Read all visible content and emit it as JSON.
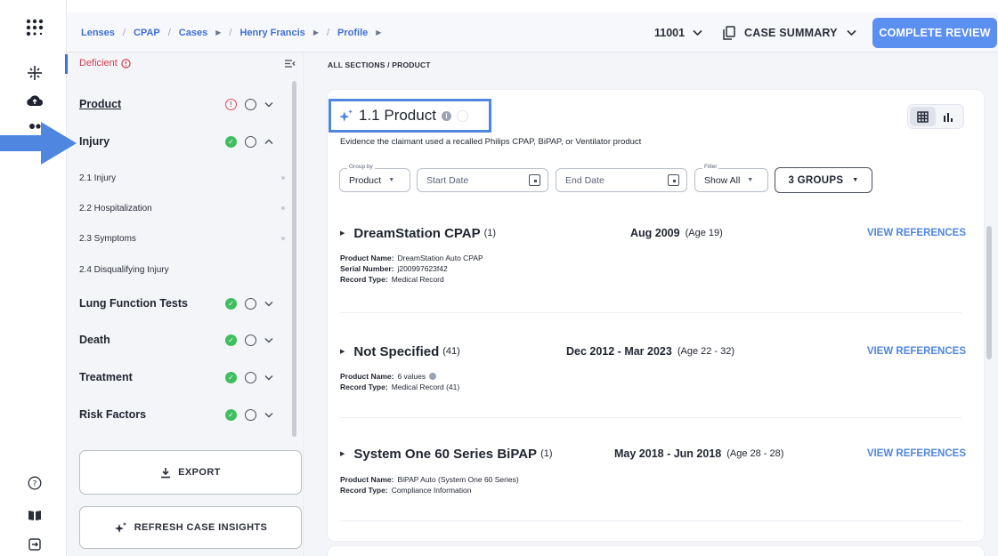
{
  "topbar": {
    "breadcrumbs": [
      "Lenses",
      "CPAP",
      "Cases",
      "Henry Francis",
      "Profile"
    ],
    "case_id": "11001",
    "summary_label": "CASE SUMMARY",
    "complete_label": "COMPLETE REVIEW"
  },
  "sidebar": {
    "filter_label": "Deficient",
    "sections": [
      {
        "label": "Product",
        "status": "deficient"
      },
      {
        "label": "Injury",
        "status": "ok"
      },
      {
        "label": "Lung Function Tests",
        "status": "ok"
      },
      {
        "label": "Death",
        "status": "ok"
      },
      {
        "label": "Treatment",
        "status": "ok"
      },
      {
        "label": "Risk Factors",
        "status": "ok"
      }
    ],
    "subsections": [
      "2.1 Injury",
      "2.2 Hospitalization",
      "2.3 Symptoms",
      "2.4 Disqualifying Injury"
    ],
    "export_label": "EXPORT",
    "refresh_label": "REFRESH CASE INSIGHTS"
  },
  "main": {
    "path": "ALL SECTIONS  /  PRODUCT",
    "title": "1.1 Product",
    "description": "Evidence the claimant used a recalled Philips CPAP, BiPAP, or Ventilator product",
    "filters": {
      "group_by_label": "Group by",
      "group_by_value": "Product",
      "start_date_placeholder": "Start Date",
      "end_date_placeholder": "End Date",
      "filter_label": "Filter",
      "filter_value": "Show All",
      "groups_label": "3 GROUPS"
    },
    "groups": [
      {
        "name": "DreamStation CPAP",
        "count": "(1)",
        "date": "Aug 2009",
        "age": "(Age 19)",
        "ref_label": "VIEW REFERENCES",
        "rows": [
          {
            "key": "Product Name:",
            "value": "DreamStation Auto CPAP"
          },
          {
            "key": "Serial Number:",
            "value": "j200997623f42"
          },
          {
            "key": "Record Type:",
            "value": "Medical Record"
          }
        ]
      },
      {
        "name": "Not Specified",
        "count": "(41)",
        "date": "Dec 2012 - Mar 2023",
        "age": "(Age 22 - 32)",
        "ref_label": "VIEW REFERENCES",
        "rows": [
          {
            "key": "Product Name:",
            "value": "6 values"
          },
          {
            "key": "Record Type:",
            "value": "Medical Record (41)"
          }
        ]
      },
      {
        "name": "System One 60 Series BiPAP",
        "count": "(1)",
        "date": "May 2018 - Jun 2018",
        "age": "(Age 28 - 28)",
        "ref_label": "VIEW REFERENCES",
        "rows": [
          {
            "key": "Product Name:",
            "value": "BiPAP Auto (System One 60 Series)"
          },
          {
            "key": "Record Type:",
            "value": "Compliance Information"
          }
        ]
      }
    ]
  },
  "colors": {
    "accent": "#4f86e0",
    "primary_button": "#5b8ff0",
    "ok": "#3fbf5f",
    "deficient": "#e24a58"
  }
}
